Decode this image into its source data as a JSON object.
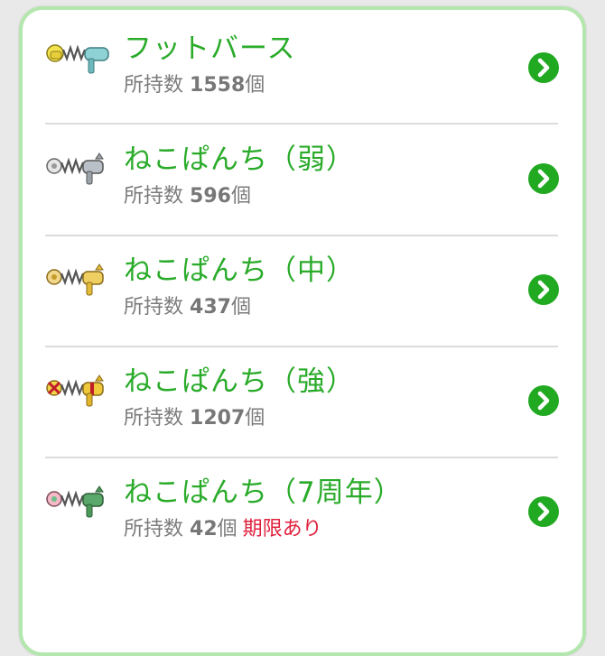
{
  "colors": {
    "accent_green": "#2aab2a",
    "chevron_green": "#21a921",
    "card_border": "#b4e7ae",
    "expiry_red": "#e0203d"
  },
  "items": [
    {
      "name": "フットバース",
      "owned_label": "所持数",
      "count": "1558",
      "unit": "個",
      "expiry": "",
      "icon": "foot-bath-spring-icon"
    },
    {
      "name": "ねこぱんち（弱）",
      "owned_label": "所持数",
      "count": "596",
      "unit": "個",
      "expiry": "",
      "icon": "cat-punch-weak-icon"
    },
    {
      "name": "ねこぱんち（中）",
      "owned_label": "所持数",
      "count": "437",
      "unit": "個",
      "expiry": "",
      "icon": "cat-punch-medium-icon"
    },
    {
      "name": "ねこぱんち（強）",
      "owned_label": "所持数",
      "count": "1207",
      "unit": "個",
      "expiry": "",
      "icon": "cat-punch-strong-icon"
    },
    {
      "name": "ねこぱんち（7周年）",
      "owned_label": "所持数",
      "count": "42",
      "unit": "個",
      "expiry": "期限あり",
      "icon": "cat-punch-7th-anniversary-icon"
    }
  ]
}
